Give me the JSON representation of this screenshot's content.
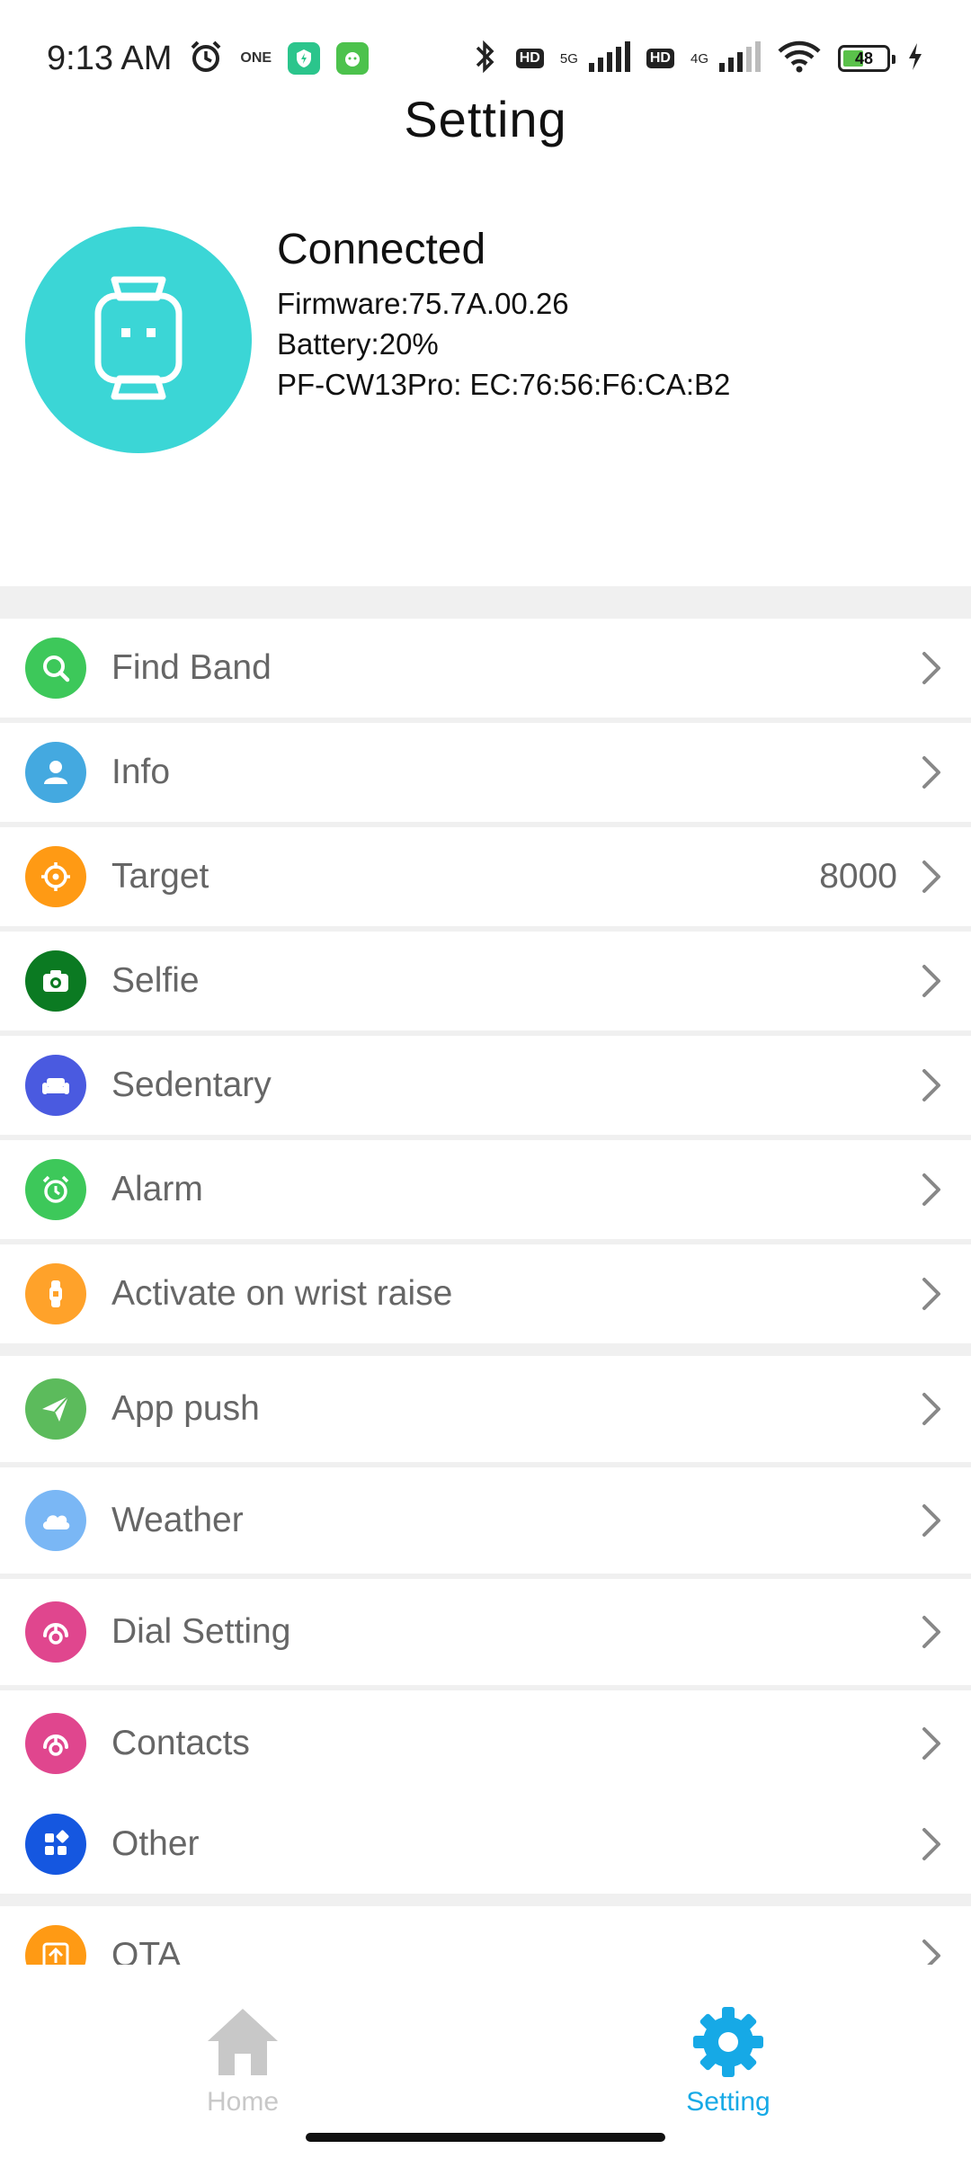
{
  "status_bar": {
    "time": "9:13 AM",
    "small_label": "ONE",
    "net1": "5G",
    "net2": "4G",
    "hd": "HD",
    "battery": "48"
  },
  "header": {
    "title": "Setting"
  },
  "device": {
    "status": "Connected",
    "firmware": "Firmware:75.7A.00.26",
    "battery": "Battery:20%",
    "model_mac": "PF-CW13Pro: EC:76:56:F6:CA:B2"
  },
  "settings": [
    {
      "label": "Find Band",
      "icon": "search-icon",
      "color": "#3dc85a"
    },
    {
      "label": "Info",
      "icon": "user-icon",
      "color": "#44a9e0"
    },
    {
      "label": "Target",
      "icon": "target-icon",
      "color": "#ff9a14",
      "value": "8000"
    },
    {
      "label": "Selfie",
      "icon": "camera-icon",
      "color": "#0b7a22"
    },
    {
      "label": "Sedentary",
      "icon": "sofa-icon",
      "color": "#4a5ae0"
    },
    {
      "label": "Alarm",
      "icon": "alarm-clock-icon",
      "color": "#3dc85a"
    },
    {
      "label": "Activate on wrist raise",
      "icon": "watch-icon",
      "color": "#ffa22a"
    },
    {
      "label": "App push",
      "icon": "paper-plane-icon",
      "color": "#5cbb5c"
    },
    {
      "label": "Weather",
      "icon": "cloud-icon",
      "color": "#7ab7f5"
    },
    {
      "label": "Dial Setting",
      "icon": "dial-icon",
      "color": "#e0468e"
    },
    {
      "label": "Contacts",
      "icon": "contacts-icon",
      "color": "#e0468e"
    },
    {
      "label": "Other",
      "icon": "grid-icon",
      "color": "#1557e0"
    },
    {
      "label": "OTA",
      "icon": "upload-icon",
      "color": "#ff9a14"
    }
  ],
  "bottom_nav": {
    "home": "Home",
    "setting": "Setting",
    "active_color": "#16a9e6",
    "inactive_color": "#c8c8c8"
  }
}
